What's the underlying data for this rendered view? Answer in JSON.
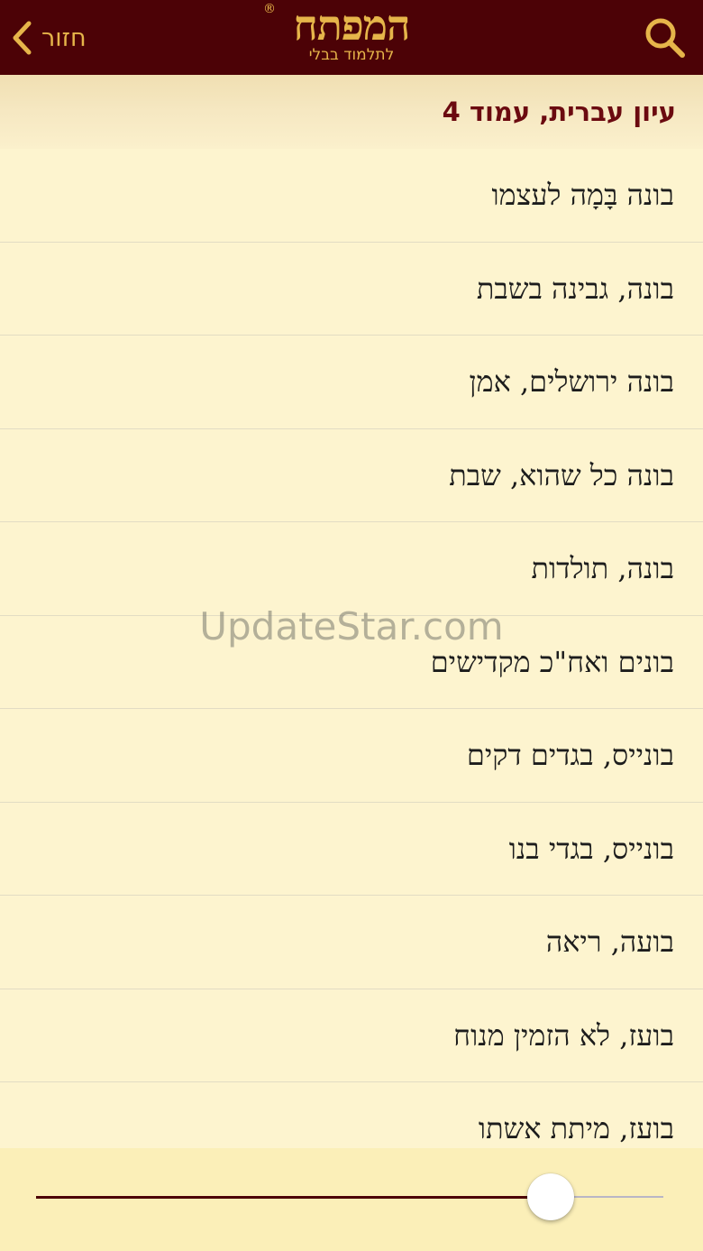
{
  "header": {
    "back_label": "חזור",
    "logo_main": "המפתח",
    "logo_sub": "לתלמוד בבלי",
    "logo_reg": "®",
    "accent_color": "#e6b54a",
    "bar_color": "#4c0206"
  },
  "subheader": {
    "title": "עיון עברית, עמוד 4"
  },
  "list": {
    "items": [
      "בונה בָּמָה לעצמו",
      "בונה, גבינה בשבת",
      "בונה ירושלים, אמן",
      "בונה כל שהוא, שבת",
      "בונה, תולדות",
      "בונים ואח\"כ מקדישים",
      "בונייס, בגדים דקים",
      "בונייס, בגדי בנו",
      "בועה, ריאה",
      "בועז, לא הזמין מנוח",
      "בועז, מיתת אשתו"
    ]
  },
  "watermark": "UpdateStar.com",
  "slider": {
    "value": 0.82
  }
}
